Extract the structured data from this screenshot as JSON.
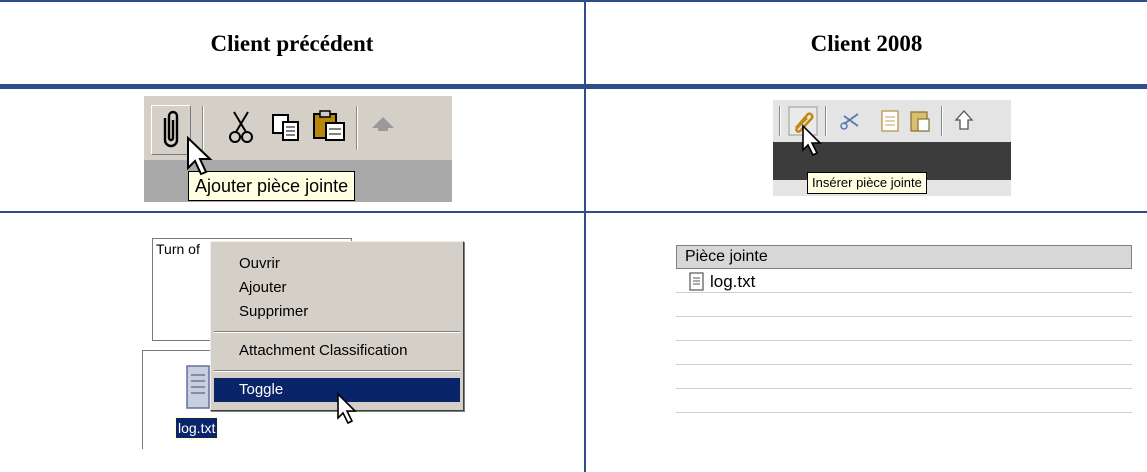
{
  "columns": {
    "left_header": "Client précédent",
    "right_header": "Client 2008"
  },
  "classic_toolbar": {
    "tooltip": "Ajouter pièce jointe",
    "icons": [
      "paperclip-icon",
      "scissors-icon",
      "copy-icon",
      "paste-icon",
      "up-arrow-icon"
    ]
  },
  "new_toolbar": {
    "tooltip": "Insérer pièce jointe",
    "icons": [
      "paperclip-icon",
      "scissors-icon",
      "copy-icon",
      "paste-icon",
      "up-arrow-icon"
    ]
  },
  "classic_context": {
    "textbox_text": "Turn of",
    "menu_items": {
      "open": "Ouvrir",
      "add": "Ajouter",
      "delete": "Supprimer",
      "classification": "Attachment Classification",
      "toggle": "Toggle"
    },
    "file_name": "log.txt"
  },
  "new_attachments": {
    "column_header": "Pièce jointe",
    "file_name": "log.txt"
  },
  "colors": {
    "rule": "#2d4e8a",
    "menu_highlight": "#0a246a",
    "tooltip_bg": "#ffffe1"
  }
}
